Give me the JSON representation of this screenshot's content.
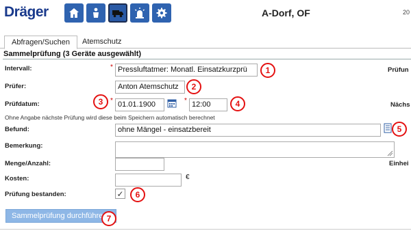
{
  "header": {
    "logo": "Dräger",
    "station": "A-Dorf, OF",
    "right_text": "20",
    "nav_icons": [
      "home-icon",
      "person-icon",
      "truck-icon",
      "alarm-icon",
      "gear-icon"
    ]
  },
  "tabs": [
    {
      "label": "Abfragen/Suchen",
      "active": true
    },
    {
      "label": "Atemschutz",
      "active": false
    }
  ],
  "section_title": "Sammelprüfung (3 Geräte ausgewählt)",
  "form": {
    "intervall_label": "Intervall:",
    "intervall_value": "Pressluftatmer: Monatl. Einsatzkurzprü",
    "pruefer_label": "Prüfer:",
    "pruefer_value": "Anton Atemschutz",
    "pruefdatum_label": "Prüfdatum:",
    "pruefdatum_value": "01.01.1900",
    "time_value": "12:00",
    "note": "Ohne Angabe nächste Prüfung wird diese beim Speichern automatisch berechnet",
    "befund_label": "Befund:",
    "befund_value": "ohne Mängel - einsatzbereit",
    "bemerkung_label": "Bemerkung:",
    "bemerkung_value": "",
    "menge_label": "Menge/Anzahl:",
    "menge_value": "",
    "kosten_label": "Kosten:",
    "kosten_value": "",
    "currency": "€",
    "bestanden_label": "Prüfung bestanden:",
    "bestanden_checked": "✓",
    "submit_label": "Sammelprüfung durchführen",
    "right_labels": {
      "pruefun": "Prüfun",
      "naechs": "Nächs",
      "einhei": "Einhei"
    },
    "required_mark": "*"
  },
  "badges": [
    "1",
    "2",
    "3",
    "4",
    "5",
    "6",
    "7"
  ],
  "colors": {
    "nav_blue": "#2f63b0",
    "badge_red": "#e41010",
    "button_blue": "#8eb7e6",
    "logo_blue": "#1a3a8c"
  }
}
